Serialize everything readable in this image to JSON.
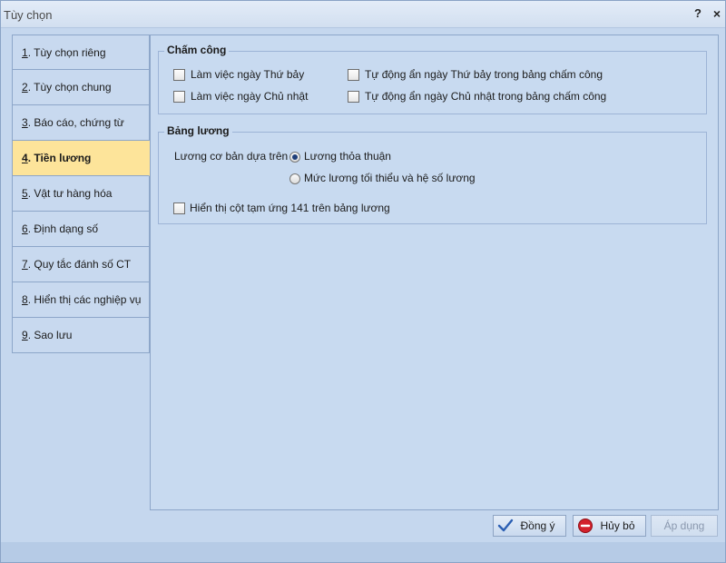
{
  "window": {
    "title": "Tùy chọn",
    "help_glyph": "?",
    "close_glyph": "×"
  },
  "nav": {
    "items": [
      {
        "num": "1",
        "label": ". Tùy chọn riêng"
      },
      {
        "num": "2",
        "label": ". Tùy chọn chung"
      },
      {
        "num": "3",
        "label": ". Báo cáo, chứng từ"
      },
      {
        "num": "4",
        "label": ". Tiền lương"
      },
      {
        "num": "5",
        "label": ". Vật tư hàng hóa"
      },
      {
        "num": "6",
        "label": ". Định dạng số"
      },
      {
        "num": "7",
        "label": ". Quy tắc đánh số CT"
      },
      {
        "num": "8",
        "label": ". Hiển thị các nghiệp vụ"
      },
      {
        "num": "9",
        "label": ". Sao lưu"
      }
    ],
    "active_index": 3
  },
  "cham_cong": {
    "title": "Chấm công",
    "saturday": {
      "label": "Làm việc ngày Thứ bảy",
      "checked": false
    },
    "sunday": {
      "label": "Làm việc ngày Chủ nhật",
      "checked": false
    },
    "auto_hide_saturday": {
      "label": "Tự động ẩn ngày Thứ bảy trong bảng chấm công",
      "checked": false
    },
    "auto_hide_sunday": {
      "label": "Tự động ẩn ngày Chủ nhật trong bảng chấm công",
      "checked": false
    }
  },
  "bang_luong": {
    "title": "Bảng lương",
    "basis_label": "Lương cơ bản dựa trên",
    "option_agreed": {
      "label": "Lương thỏa thuận",
      "selected": true
    },
    "option_min_coef": {
      "label": "Mức lương tối thiểu và hệ số lương",
      "selected": false
    },
    "show_advance": {
      "label": "Hiển thị cột tạm ứng 141 trên bảng lương",
      "checked": false
    }
  },
  "buttons": {
    "ok": "Đồng ý",
    "cancel": "Hủy bỏ",
    "apply": "Áp dụng"
  },
  "colors": {
    "active_tab": "#fde49a",
    "ok_icon": "#2b5fb3",
    "cancel_icon": "#d3212c"
  }
}
